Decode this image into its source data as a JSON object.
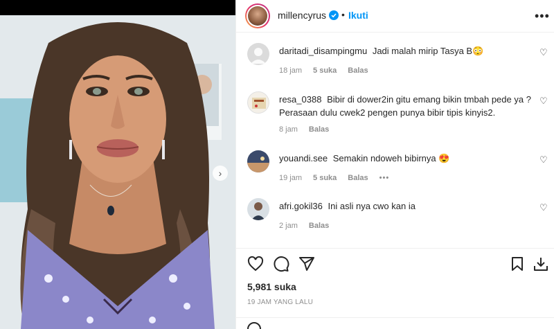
{
  "post": {
    "username": "millencyrus",
    "separator": "•",
    "follow_label": "Ikuti",
    "more_label": "•••"
  },
  "comments": [
    {
      "user": "daritadi_disampingmu",
      "text": "Jadi malah mirip Tasya B😳",
      "time": "18 jam",
      "likes": "5 suka",
      "reply": "Balas"
    },
    {
      "user": "resa_0388",
      "text": "Bibir di dower2in gitu emang bikin tmbah pede ya ? Perasaan dulu cwek2 pengen punya bibir tipis kinyis2.",
      "time": "8 jam",
      "reply": "Balas"
    },
    {
      "user": "youandi.see",
      "text": "Semakin ndoweh bibirnya 😍",
      "time": "19 jam",
      "likes": "5 suka",
      "reply": "Balas",
      "more": "•••"
    },
    {
      "user": "afri.gokil36",
      "text": "Ini asli nya cwo kan ia",
      "time": "2 jam",
      "reply": "Balas"
    }
  ],
  "footer": {
    "likes": "5,981 suka",
    "time_ago": "19 JAM YANG LALU"
  },
  "icons": {
    "heart": "heart-icon",
    "comment": "comment-icon",
    "share": "share-icon",
    "save": "bookmark-icon",
    "save_alt": "download-icon",
    "next": "chevron-right-icon",
    "verified": "verified-badge-icon"
  },
  "colors": {
    "accent": "#0095f6",
    "text": "#262626",
    "muted": "#8e8e8e"
  }
}
